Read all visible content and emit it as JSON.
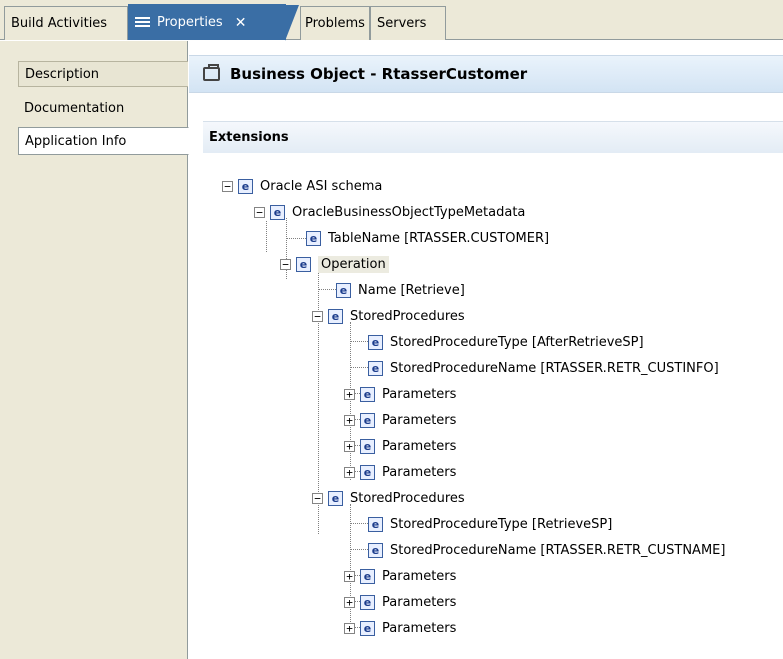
{
  "tabs": {
    "build": "Build Activities",
    "properties": "Properties",
    "properties_close": "✕",
    "problems": "Problems",
    "servers": "Servers"
  },
  "nav": {
    "description": "Description",
    "documentation": "Documentation",
    "application_info": "Application Info"
  },
  "header": {
    "title": "Business Object - RtasserCustomer"
  },
  "extensions": {
    "title": "Extensions"
  },
  "tree": {
    "n0": "Oracle ASI schema",
    "n1": "OracleBusinessObjectTypeMetadata",
    "n2": "TableName [RTASSER.CUSTOMER]",
    "n3": "Operation",
    "n4": "Name [Retrieve]",
    "n5": "StoredProcedures",
    "n6": "StoredProcedureType [AfterRetrieveSP]",
    "n7": "StoredProcedureName [RTASSER.RETR_CUSTINFO]",
    "n8": "Parameters",
    "n9": "Parameters",
    "n10": "Parameters",
    "n11": "Parameters",
    "n12": "StoredProcedures",
    "n13": "StoredProcedureType [RetrieveSP]",
    "n14": "StoredProcedureName [RTASSER.RETR_CUSTNAME]",
    "n15": "Parameters",
    "n16": "Parameters",
    "n17": "Parameters",
    "element_glyph": "e",
    "minus": "−",
    "plus": "+"
  }
}
